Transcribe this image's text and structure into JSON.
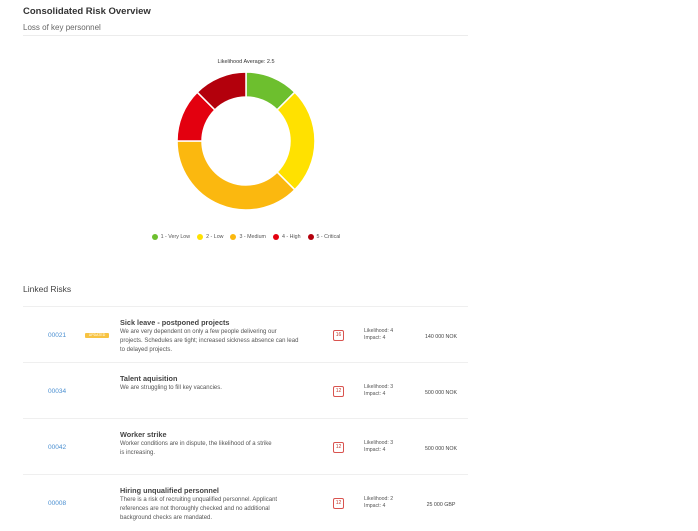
{
  "header": {
    "title": "Consolidated Risk Overview",
    "subtitle": "Loss of key personnel"
  },
  "chart": {
    "caption": "Likelihood Average: 2.5"
  },
  "chart_data": {
    "type": "pie",
    "title": "Likelihood Average: 2.5",
    "legend_position": "bottom",
    "slices": [
      {
        "label": "1 - Very Low",
        "value": 12.5,
        "color": "#6dbf2e"
      },
      {
        "label": "2 - Low",
        "value": 25,
        "color": "#ffe100"
      },
      {
        "label": "3 - Medium",
        "value": 37.5,
        "color": "#fbb80f"
      },
      {
        "label": "4 - High",
        "value": 12.5,
        "color": "#e3000f"
      },
      {
        "label": "5 - Critical",
        "value": 12.5,
        "color": "#b3000c"
      }
    ]
  },
  "linked_risks": {
    "title": "Linked Risks",
    "rows": [
      {
        "id": "00021",
        "tag": "UPDATED",
        "title": "Sick leave - postponed projects",
        "desc_lines": [
          "We are very dependent on only a few people delivering our",
          "projects. Schedules are tight; increased sickness absence can lead",
          "to delayed projects."
        ],
        "score": "16",
        "likelihood": "Likelihood: 4",
        "impact": "Impact: 4",
        "value": "140 000 NOK"
      },
      {
        "id": "00034",
        "title": "Talent aquisition",
        "desc_lines": [
          "We are struggling to fill key vacancies."
        ],
        "score": "12",
        "likelihood": "Likelihood: 3",
        "impact": "Impact: 4",
        "value": "500 000 NOK"
      },
      {
        "id": "00042",
        "title": "Worker strike",
        "desc_lines": [
          "Worker conditions are in dispute, the likelihood of a strike",
          "is increasing."
        ],
        "score": "12",
        "likelihood": "Likelihood: 3",
        "impact": "Impact: 4",
        "value": "500 000 NOK"
      },
      {
        "id": "00008",
        "title": "Hiring unqualified personnel",
        "desc_lines": [
          "There is a risk of recruiting unqualified personnel. Applicant",
          "references are not thoroughly checked and no additional",
          "background checks are mandated."
        ],
        "score": "12",
        "likelihood": "Likelihood: 2",
        "impact": "Impact: 4",
        "value": "25 000 GBP"
      }
    ]
  }
}
